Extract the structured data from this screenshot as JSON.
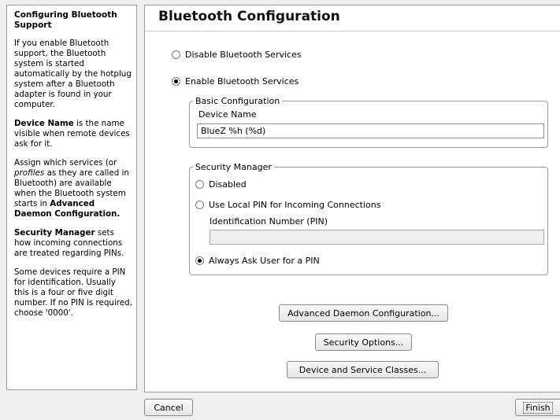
{
  "help": {
    "title": "Configuring Bluetooth Support",
    "p1": "If you enable Bluetooth support, the Bluetooth system is started automatically by the hotplug system after a Bluetooth adapter is found in your computer.",
    "p2_bold": "Device Name",
    "p2_rest": " is the name visible when remote devices ask for it.",
    "p3_a": "Assign which services (or ",
    "p3_italic": "profiles",
    "p3_b": " as they are called in Bluetooth) are available when the Bluetooth system starts in ",
    "p3_bold": "Advanced Daemon Configuration.",
    "p4_bold": "Security Manager",
    "p4_rest": " sets how incoming connections are treated regarding PINs.",
    "p5": "Some devices require a PIN for identification. Usually this is a four or five digit number. If no PIN is required, choose '0000'."
  },
  "main": {
    "title": "Bluetooth Configuration",
    "service": {
      "disable_label": "Disable Bluetooth Services",
      "enable_label": "Enable Bluetooth Services",
      "selected": "enable"
    },
    "basic": {
      "legend": "Basic Configuration",
      "device_name_label": "Device Name",
      "device_name_value": "BlueZ %h (%d)"
    },
    "security": {
      "legend": "Security Manager",
      "disabled_label": "Disabled",
      "local_pin_label": "Use Local PIN for Incoming Connections",
      "pin_label": "Identification Number (PIN)",
      "pin_value": "",
      "ask_label": "Always Ask User for a PIN",
      "selected": "ask"
    },
    "buttons": {
      "advanced": "Advanced Daemon Configuration...",
      "security": "Security Options...",
      "classes": "Device and Service Classes..."
    }
  },
  "footer": {
    "cancel": "Cancel",
    "finish": "Finish"
  }
}
